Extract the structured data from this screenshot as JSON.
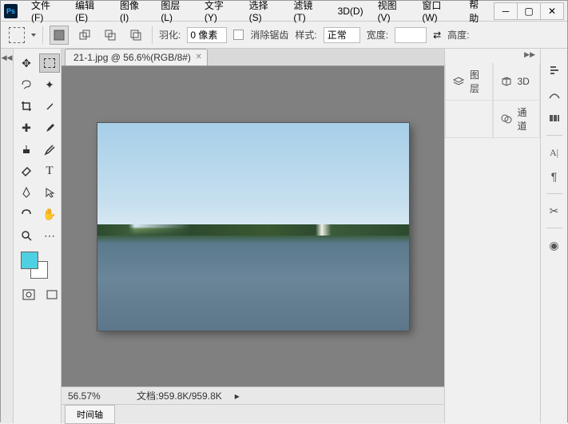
{
  "menu": {
    "items": [
      "文件(F)",
      "编辑(E)",
      "图像(I)",
      "图层(L)",
      "文字(Y)",
      "选择(S)",
      "滤镜(T)",
      "3D(D)",
      "视图(V)",
      "窗口(W)",
      "帮助"
    ]
  },
  "options": {
    "feather_label": "羽化:",
    "feather_value": "0 像素",
    "antialias_label": "消除锯齿",
    "style_label": "样式:",
    "style_value": "正常",
    "width_label": "宽度:",
    "height_label": "高度:"
  },
  "document": {
    "tab_title": "21-1.jpg @ 56.6%(RGB/8#)",
    "zoom": "56.57%",
    "docinfo_label": "文档:",
    "docinfo_value": "959.8K/959.8K"
  },
  "bottom": {
    "timeline": "时间轴"
  },
  "panels": {
    "layers": "图层",
    "threeD": "3D",
    "channels": "通道"
  },
  "swatch": {
    "fg": "#4dd0e1",
    "bg": "#ffffff"
  }
}
